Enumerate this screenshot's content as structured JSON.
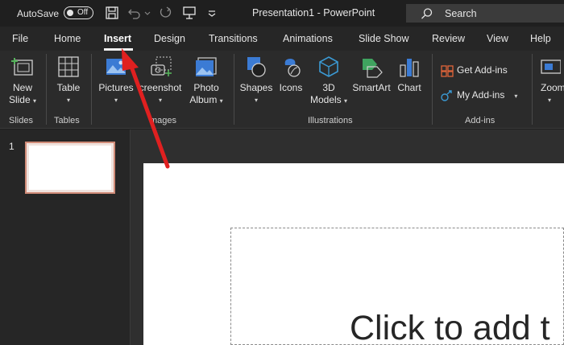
{
  "titlebar": {
    "autosave_label": "AutoSave",
    "autosave_state": "Off",
    "document_title": "Presentation1  -  PowerPoint",
    "search_placeholder": "Search",
    "icons": [
      "save-icon",
      "undo-icon",
      "redo-icon",
      "present-icon",
      "customize-quick-access-icon",
      "search-icon"
    ]
  },
  "tabs": [
    {
      "label": "File"
    },
    {
      "label": "Home"
    },
    {
      "label": "Insert",
      "active": true
    },
    {
      "label": "Design"
    },
    {
      "label": "Transitions"
    },
    {
      "label": "Animations"
    },
    {
      "label": "Slide Show"
    },
    {
      "label": "Review"
    },
    {
      "label": "View"
    },
    {
      "label": "Help"
    }
  ],
  "ribbon": {
    "slides_group": {
      "label": "Slides",
      "new_slide_line1": "New",
      "new_slide_line2": "Slide"
    },
    "tables_group": {
      "label": "Tables",
      "table": "Table"
    },
    "images_group": {
      "label": "Images",
      "visible_label": "mages",
      "pictures": "Pictures",
      "screenshot": "Screenshot",
      "visible_screenshot": "creenshot",
      "photo_album_line1": "Photo",
      "photo_album_line2": "Album"
    },
    "illustrations_group": {
      "label": "Illustrations",
      "shapes": "Shapes",
      "icons": "Icons",
      "models_line1": "3D",
      "models_line2": "Models",
      "smartart": "SmartArt",
      "chart": "Chart"
    },
    "addins_group": {
      "label": "Add-ins",
      "get_addins": "Get Add-ins",
      "my_addins": "My Add-ins"
    },
    "zoom": "Zoom"
  },
  "thumbnails": {
    "slide_number": "1"
  },
  "slide": {
    "title_placeholder": "Click to add t"
  },
  "colors": {
    "accent": "#d35230",
    "arrow": "#e02020",
    "thumb_border": "#d08b78"
  }
}
